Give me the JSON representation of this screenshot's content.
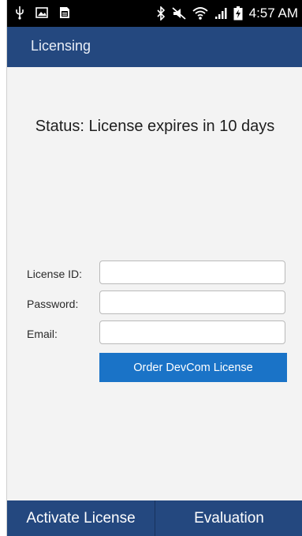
{
  "status_bar": {
    "time": "4:57 AM",
    "icons_left": [
      "usb-icon",
      "image-icon",
      "sd-card-icon"
    ],
    "icons_right": [
      "bluetooth-icon",
      "mute-icon",
      "wifi-icon",
      "signal-icon",
      "battery-charging-icon"
    ]
  },
  "action_bar": {
    "title": "Licensing"
  },
  "main": {
    "status_text": "Status: License expires in 10 days"
  },
  "form": {
    "license_id": {
      "label": "License ID:",
      "value": ""
    },
    "password": {
      "label": "Password:",
      "value": ""
    },
    "email": {
      "label": "Email:",
      "value": ""
    },
    "order_button_label": "Order DevCom License"
  },
  "bottom_bar": {
    "activate_label": "Activate License",
    "evaluation_label": "Evaluation"
  },
  "colors": {
    "accent_blue": "#24487f",
    "button_blue": "#1a73c7",
    "background": "#f3f3f3"
  }
}
